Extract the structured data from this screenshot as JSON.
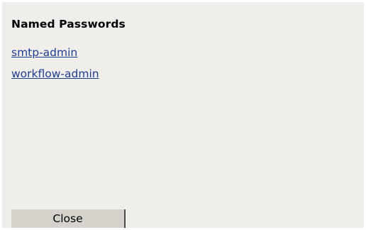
{
  "dialog": {
    "title": "Named Passwords",
    "passwords": [
      {
        "label": "smtp-admin"
      },
      {
        "label": "workflow-admin"
      }
    ],
    "close_label": "Close"
  },
  "colors": {
    "panel_background": "#f0eeea",
    "link": "#1d3d91",
    "button_background": "#d5d2cb"
  }
}
